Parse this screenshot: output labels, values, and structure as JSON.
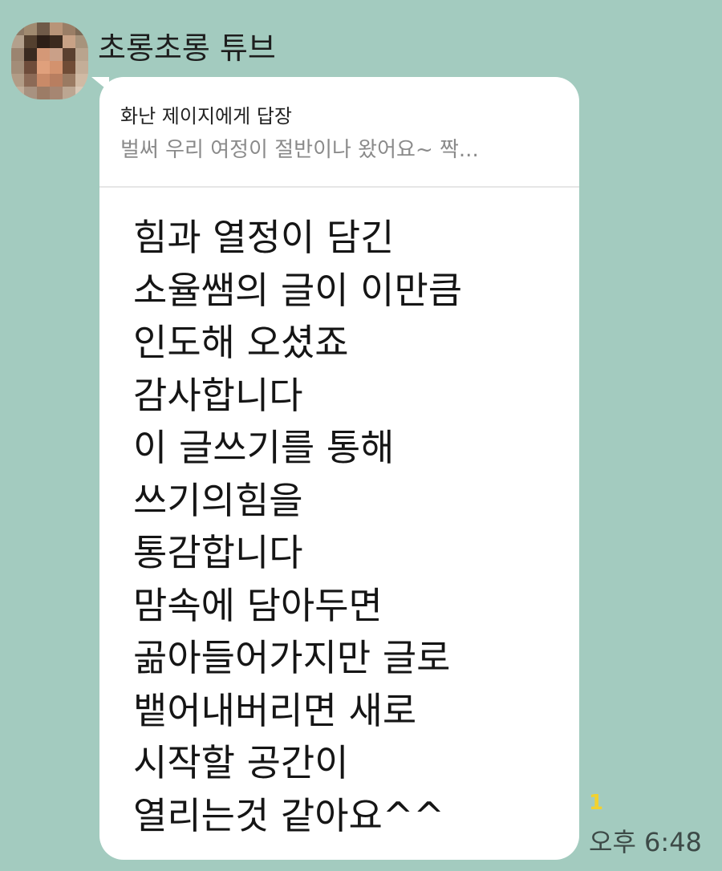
{
  "sender": {
    "name": "초롱초롱 튜브"
  },
  "reply": {
    "title": "화난 제이지에게 답장",
    "snippet": "벌써 우리 여정이 절반이나 왔어요~ 짝..."
  },
  "message": {
    "lines": [
      "힘과 열정이 담긴",
      "소율쌤의 글이 이만큼",
      "인도해 오셨죠",
      "감사합니다",
      "이 글쓰기를 통해",
      "쓰기의힘을",
      "통감합니다",
      "맘속에 담아두면",
      "곪아들어가지만 글로",
      "뱉어내버리면 새로",
      "시작할 공간이",
      "열리는것 같아요^^"
    ]
  },
  "meta": {
    "unread": "1",
    "time": "오후 6:48"
  },
  "colors": {
    "chat_background": "#a3cbbf",
    "bubble": "#ffffff",
    "unread": "#f2d22e"
  },
  "avatar_pixels": [
    "#8e7a66",
    "#a08a70",
    "#6f5a48",
    "#b89478",
    "#9a7e66",
    "#7d6a56",
    "#b3a08c",
    "#54402f",
    "#2d1f17",
    "#3b2a1e",
    "#c8a286",
    "#a7937c",
    "#9b8470",
    "#3a2a20",
    "#d49877",
    "#caa088",
    "#5a4030",
    "#b9a48e",
    "#a38d78",
    "#6e4c3a",
    "#e0a07c",
    "#d3926e",
    "#704c36",
    "#c4ae98",
    "#b29c86",
    "#8c6a56",
    "#c98a68",
    "#b87e60",
    "#9a7a62",
    "#d0baa4",
    "#c2ae9a",
    "#a89280",
    "#9c7c66",
    "#a68672",
    "#bca692",
    "#dac8b6"
  ]
}
